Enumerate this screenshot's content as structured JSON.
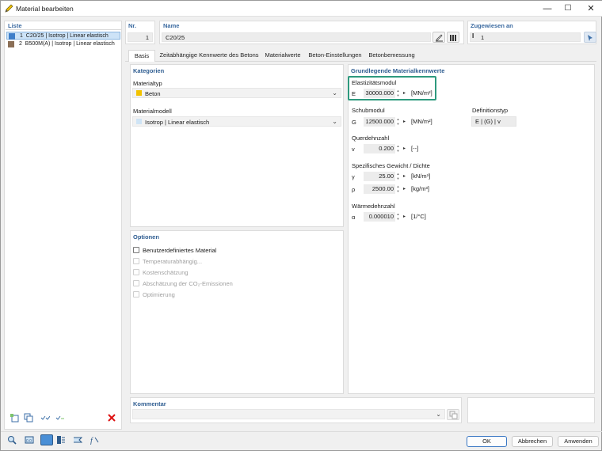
{
  "window": {
    "title": "Material bearbeiten",
    "minimize": "—",
    "maximize": "☐",
    "close": "✕"
  },
  "list": {
    "header": "Liste",
    "items": [
      {
        "num": "1",
        "text": "C20/25 | Isotrop | Linear elastisch",
        "color": "#3e7ec9"
      },
      {
        "num": "2",
        "text": "B500M(A) | Isotrop | Linear elastisch",
        "color": "#8b6f56"
      }
    ]
  },
  "header": {
    "nr_label": "Nr.",
    "nr_value": "1",
    "name_label": "Name",
    "name_value": "C20/25",
    "assigned_label": "Zugewiesen an",
    "assigned_value": "1"
  },
  "tabs": [
    "Basis",
    "Zeitabhängige Kennwerte des Betons",
    "Materialwerte",
    "Beton-Einstellungen",
    "Betonbemessung"
  ],
  "categories": {
    "title": "Kategorien",
    "material_type_label": "Materialtyp",
    "material_type_value": "Beton",
    "material_type_color": "#f2c200",
    "material_model_label": "Materialmodell",
    "material_model_value": "Isotrop | Linear elastisch",
    "material_model_color": "#cfe4f5"
  },
  "options": {
    "title": "Optionen",
    "items": [
      {
        "label": "Benutzerdefiniertes Material",
        "enabled": true
      },
      {
        "label": "Temperaturabhängig...",
        "enabled": false
      },
      {
        "label": "Kostenschätzung",
        "enabled": false
      },
      {
        "label": "Abschätzung der CO₂-Emissionen",
        "enabled": false
      },
      {
        "label": "Optimierung",
        "enabled": false
      }
    ]
  },
  "props": {
    "title": "Grundlegende Materialkennwerte",
    "e_group": "Elastizitätsmodul",
    "e_sym": "E",
    "e_val": "30000.000",
    "e_unit": "[MN/m²]",
    "g_group": "Schubmodul",
    "g_sym": "G",
    "g_val": "12500.000",
    "g_unit": "[MN/m²]",
    "def_label": "Definitionstyp",
    "def_value": "E | (G) | v",
    "nu_group": "Querdehnzahl",
    "nu_sym": "v",
    "nu_val": "0.200",
    "nu_unit": "[--]",
    "w_group": "Spezifisches Gewicht / Dichte",
    "gamma_sym": "γ",
    "gamma_val": "25.00",
    "gamma_unit": "[kN/m³]",
    "rho_sym": "ρ",
    "rho_val": "2500.00",
    "rho_unit": "[kg/m³]",
    "alpha_group": "Wärmedehnzahl",
    "alpha_sym": "α",
    "alpha_val": "0.000010",
    "alpha_unit": "[1/°C]",
    "highlight_color": "#2e9a7e"
  },
  "comment": {
    "label": "Kommentar",
    "value": ""
  },
  "buttons": {
    "ok": "OK",
    "cancel": "Abbrechen",
    "apply": "Anwenden"
  }
}
